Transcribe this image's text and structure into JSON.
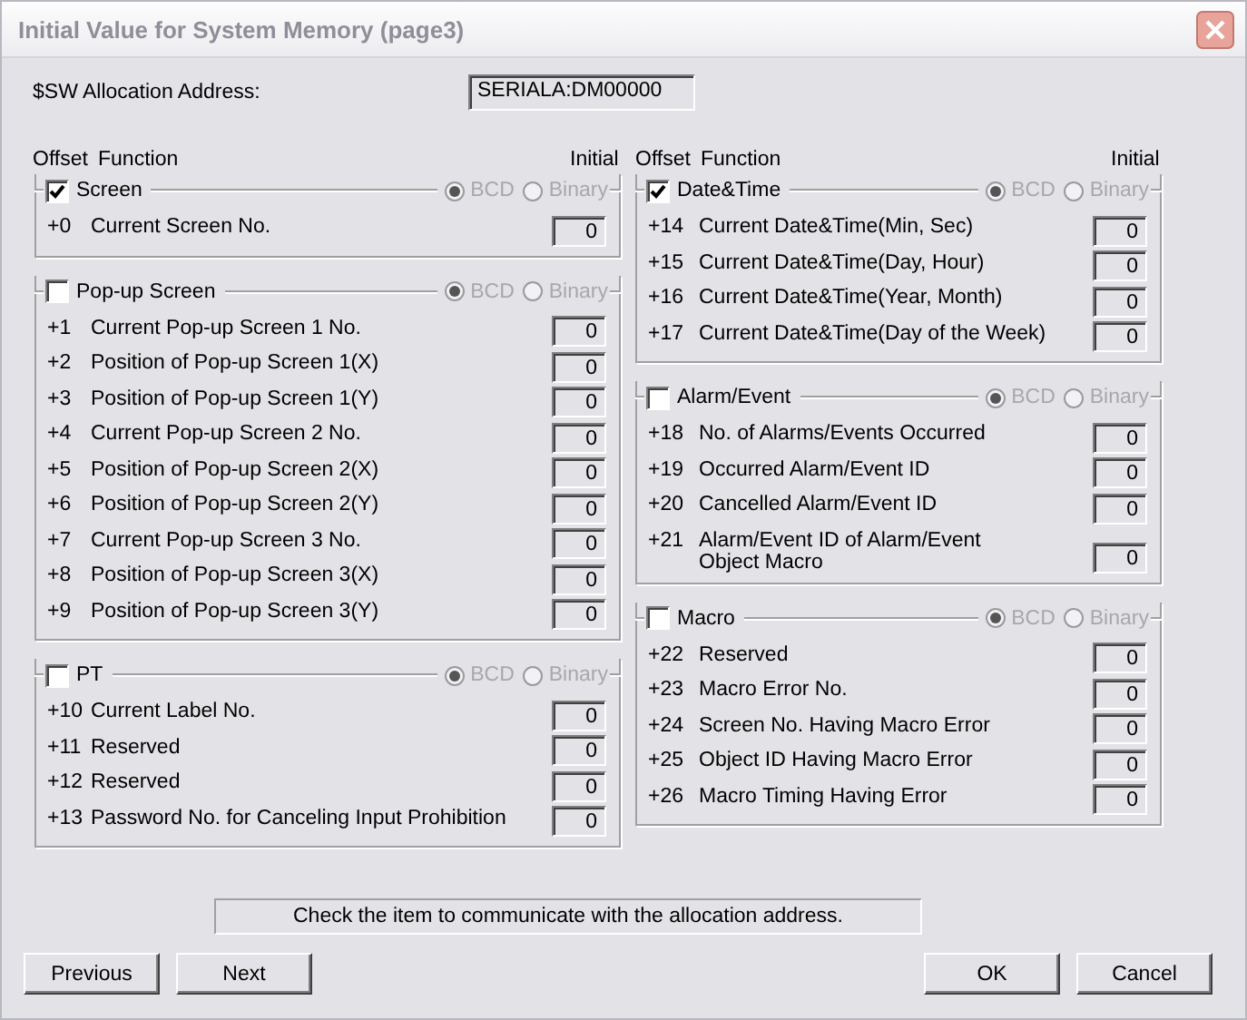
{
  "window": {
    "title": "Initial Value for System Memory (page3)"
  },
  "allocation": {
    "label": "$SW Allocation Address:",
    "value": "SERIALA:DM00000"
  },
  "columns": [
    {
      "headers": {
        "offset": "Offset",
        "function": "Function",
        "initial": "Initial"
      },
      "groups": [
        {
          "label": "Screen",
          "checked": true,
          "radios_disabled": true,
          "radios": [
            {
              "label": "BCD",
              "selected": true
            },
            {
              "label": "Binary",
              "selected": false
            }
          ],
          "rows": [
            {
              "offset": "+0",
              "function": "Current Screen No.",
              "value": "0"
            }
          ]
        },
        {
          "label": "Pop-up Screen",
          "checked": false,
          "radios_disabled": true,
          "radios": [
            {
              "label": "BCD",
              "selected": true
            },
            {
              "label": "Binary",
              "selected": false
            }
          ],
          "rows": [
            {
              "offset": "+1",
              "function": "Current Pop-up Screen 1 No.",
              "value": "0"
            },
            {
              "offset": "+2",
              "function": "Position of Pop-up Screen 1(X)",
              "value": "0"
            },
            {
              "offset": "+3",
              "function": "Position of Pop-up Screen 1(Y)",
              "value": "0"
            },
            {
              "offset": "+4",
              "function": "Current Pop-up Screen 2 No.",
              "value": "0"
            },
            {
              "offset": "+5",
              "function": "Position of Pop-up Screen 2(X)",
              "value": "0"
            },
            {
              "offset": "+6",
              "function": "Position of Pop-up Screen 2(Y)",
              "value": "0"
            },
            {
              "offset": "+7",
              "function": "Current Pop-up Screen 3 No.",
              "value": "0"
            },
            {
              "offset": "+8",
              "function": "Position of Pop-up Screen 3(X)",
              "value": "0"
            },
            {
              "offset": "+9",
              "function": "Position of Pop-up Screen 3(Y)",
              "value": "0"
            }
          ]
        },
        {
          "label": "PT",
          "checked": false,
          "radios_disabled": true,
          "radios": [
            {
              "label": "BCD",
              "selected": true
            },
            {
              "label": "Binary",
              "selected": false
            }
          ],
          "rows": [
            {
              "offset": "+10",
              "function": "Current Label No.",
              "value": "0"
            },
            {
              "offset": "+11",
              "function": "Reserved",
              "value": "0"
            },
            {
              "offset": "+12",
              "function": "Reserved",
              "value": "0"
            },
            {
              "offset": "+13",
              "function": "Password No. for Canceling Input Prohibition",
              "value": "0"
            }
          ]
        }
      ]
    },
    {
      "headers": {
        "offset": "Offset",
        "function": "Function",
        "initial": "Initial"
      },
      "groups": [
        {
          "label": "Date&Time",
          "checked": true,
          "radios_disabled": true,
          "radios": [
            {
              "label": "BCD",
              "selected": true
            },
            {
              "label": "Binary",
              "selected": false
            }
          ],
          "rows": [
            {
              "offset": "+14",
              "function": "Current Date&Time(Min, Sec)",
              "value": "0"
            },
            {
              "offset": "+15",
              "function": "Current Date&Time(Day, Hour)",
              "value": "0"
            },
            {
              "offset": "+16",
              "function": "Current Date&Time(Year, Month)",
              "value": "0"
            },
            {
              "offset": "+17",
              "function": "Current Date&Time(Day of the Week)",
              "value": "0"
            }
          ]
        },
        {
          "label": "Alarm/Event",
          "checked": false,
          "radios_disabled": true,
          "radios": [
            {
              "label": "BCD",
              "selected": true
            },
            {
              "label": "Binary",
              "selected": false
            }
          ],
          "rows": [
            {
              "offset": "+18",
              "function": "No. of Alarms/Events Occurred",
              "value": "0"
            },
            {
              "offset": "+19",
              "function": "Occurred Alarm/Event ID",
              "value": "0"
            },
            {
              "offset": "+20",
              "function": "Cancelled Alarm/Event ID",
              "value": "0"
            },
            {
              "offset": "+21",
              "function": "Alarm/Event ID of Alarm/Event\nObject Macro",
              "value": "0"
            }
          ]
        },
        {
          "label": "Macro",
          "checked": false,
          "radios_disabled": true,
          "radios": [
            {
              "label": "BCD",
              "selected": true
            },
            {
              "label": "Binary",
              "selected": false
            }
          ],
          "rows": [
            {
              "offset": "+22",
              "function": "Reserved",
              "value": "0"
            },
            {
              "offset": "+23",
              "function": "Macro Error No.",
              "value": "0"
            },
            {
              "offset": "+24",
              "function": "Screen No. Having Macro Error",
              "value": "0"
            },
            {
              "offset": "+25",
              "function": "Object ID Having Macro Error",
              "value": "0"
            },
            {
              "offset": "+26",
              "function": "Macro Timing Having Error",
              "value": "0"
            }
          ]
        }
      ]
    }
  ],
  "hint": "Check the item to communicate with the allocation address.",
  "buttons_left": [
    "Previous",
    "Next"
  ],
  "buttons_right": [
    "OK",
    "Cancel"
  ]
}
